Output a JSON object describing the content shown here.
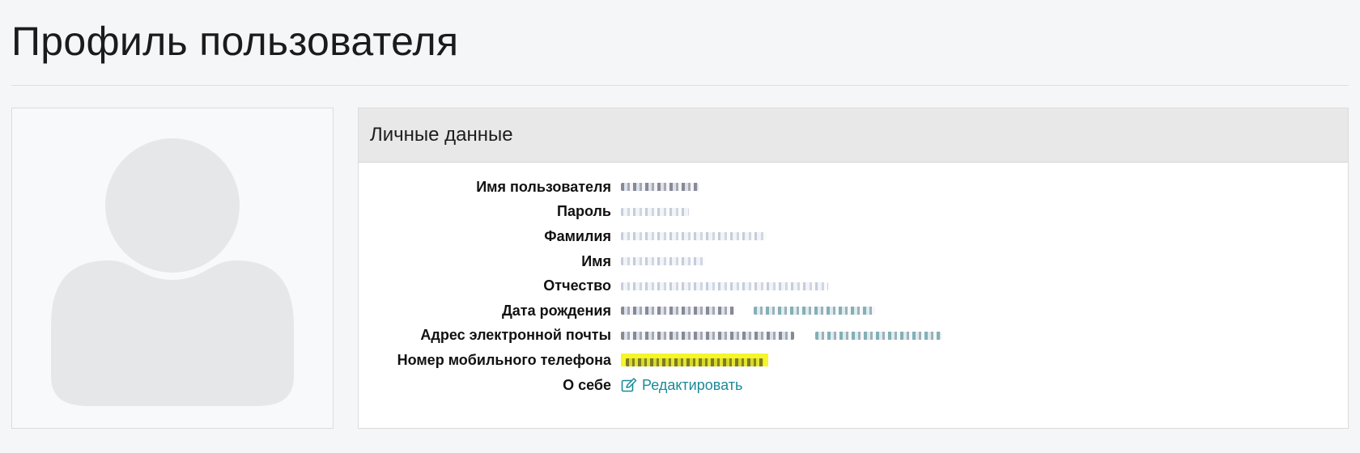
{
  "page": {
    "title": "Профиль пользователя"
  },
  "panel": {
    "title": "Личные данные"
  },
  "fields": [
    {
      "label": "Имя пользователя"
    },
    {
      "label": "Пароль"
    },
    {
      "label": "Фамилия"
    },
    {
      "label": "Имя"
    },
    {
      "label": "Отчество"
    },
    {
      "label": "Дата рождения"
    },
    {
      "label": "Адрес электронной почты"
    },
    {
      "label": "Номер мобильного телефона"
    },
    {
      "label": "О себе"
    }
  ],
  "about": {
    "edit_label": "Редактировать",
    "edit_icon": "edit-icon"
  },
  "colors": {
    "link": "#1a8a99",
    "highlight": "#f5f52a",
    "avatar_placeholder": "#e6e7e9"
  }
}
